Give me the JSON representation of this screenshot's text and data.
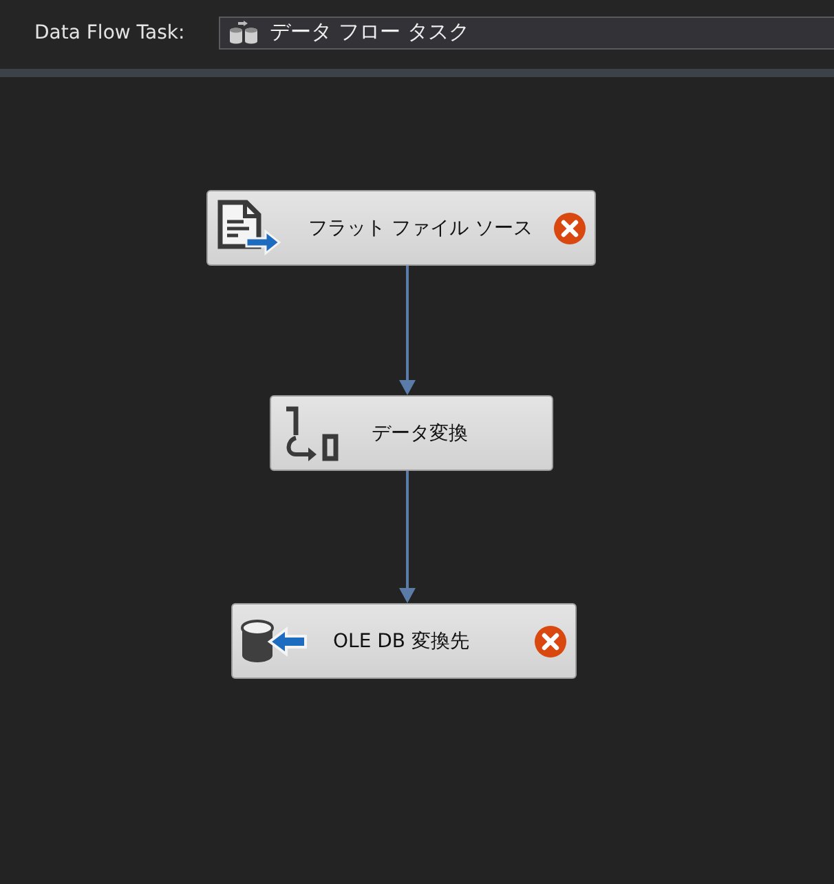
{
  "toolbar": {
    "label": "Data Flow Task:",
    "task_dropdown": {
      "value": "データ フロー タスク"
    }
  },
  "nodes": [
    {
      "kind": "source",
      "label": "フラット ファイル ソース",
      "error": true,
      "connected_to_next": true
    },
    {
      "kind": "transform",
      "label": "データ変換",
      "error": false,
      "connected_to_next": true
    },
    {
      "kind": "destination",
      "label": "OLE DB 変換先",
      "error": true,
      "connected_to_next": false
    }
  ]
}
